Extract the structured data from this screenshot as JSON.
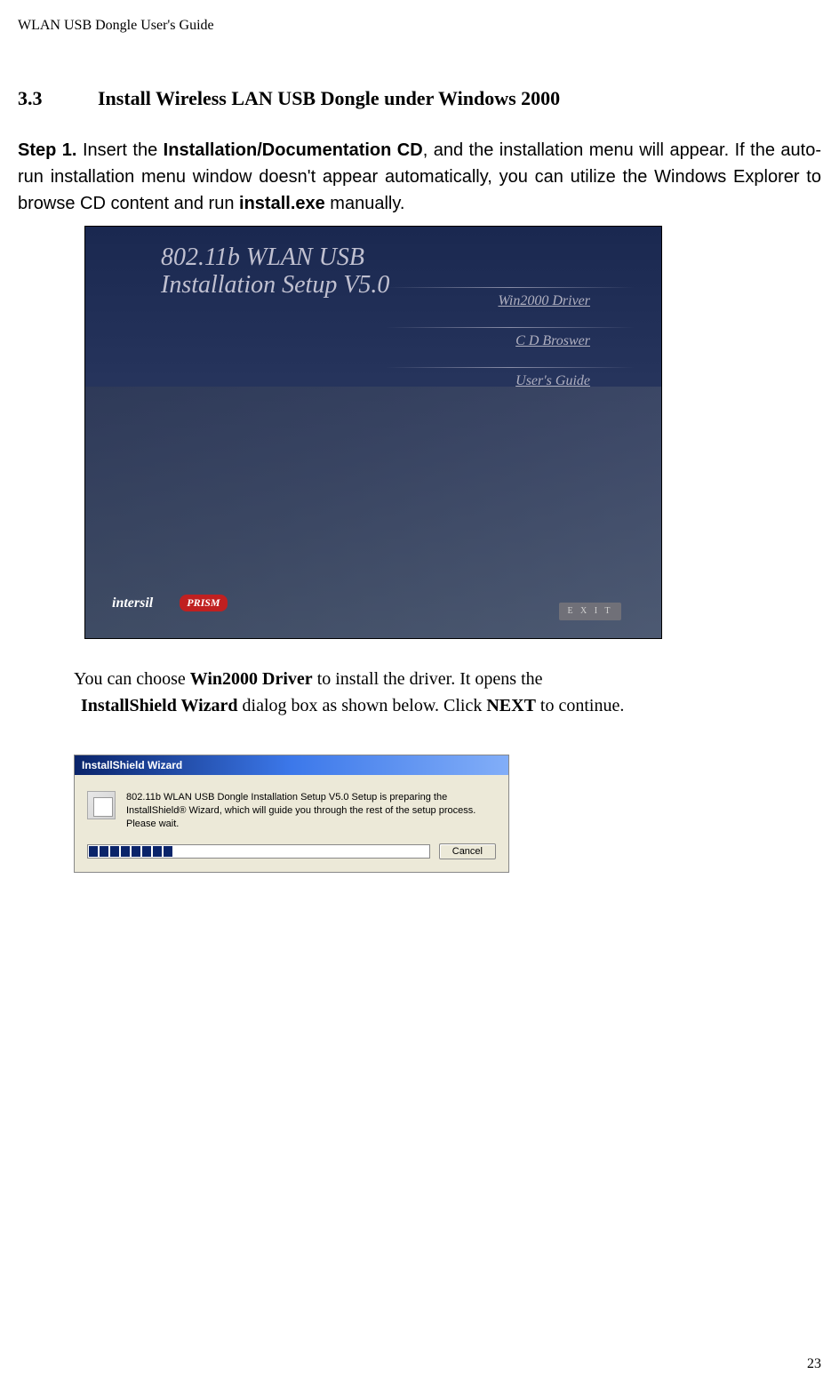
{
  "header": "WLAN USB Dongle User's Guide",
  "section": {
    "number": "3.3",
    "title": "Install Wireless LAN USB Dongle under Windows 2000"
  },
  "step": {
    "label": "Step 1.",
    "text_pre": "Insert the ",
    "bold1": "Installation/Documentation CD",
    "text_mid": ", and the installation menu will appear.    If the auto-run installation menu window doesn't appear automatically, you can utilize the Windows Explorer to browse CD content and run ",
    "bold2": "install.exe",
    "text_post": " manually."
  },
  "installer": {
    "title_line1": "802.11b WLAN  USB",
    "title_line2": "Installation Setup V5.0",
    "links": {
      "l1": "Win2000 Driver",
      "l2": "C D  Broswer",
      "l3": "User's Guide"
    },
    "exit": "E X I T",
    "logo1": "intersil",
    "logo2": "PRISM"
  },
  "after_image": {
    "line1_pre": "You can choose ",
    "line1_bold": "Win2000 Driver",
    "line1_post": " to install the driver. It opens the",
    "line2_bold1": "InstallShield Wizard",
    "line2_mid": " dialog box as shown below. Click ",
    "line2_bold2": "NEXT",
    "line2_post": " to continue."
  },
  "wizard": {
    "title": "InstallShield Wizard",
    "body": "802.11b WLAN USB Dongle Installation Setup V5.0 Setup is preparing the InstallShield® Wizard, which will guide you through the rest of the setup process. Please wait.",
    "cancel": "Cancel"
  },
  "page_number": "23"
}
